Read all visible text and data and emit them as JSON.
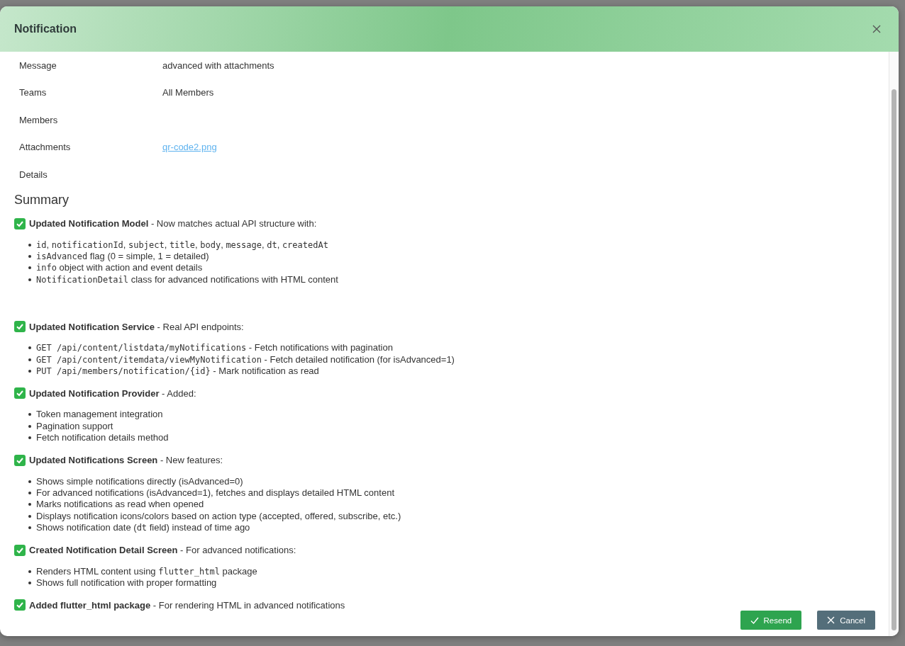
{
  "dialog": {
    "title": "Notification",
    "fields": [
      {
        "label": "Message",
        "value": "advanced with attachments",
        "kind": "text"
      },
      {
        "label": "Teams",
        "value": "All Members",
        "kind": "text"
      },
      {
        "label": "Members"
      },
      {
        "label": "Attachments",
        "value": "qr-code2.png",
        "kind": "link"
      },
      {
        "label": "Details"
      }
    ],
    "summary": {
      "heading": "Summary",
      "sections": [
        {
          "heading": "**Updated Notification Model** - Now matches actual API structure with:",
          "items": [
            [
              {
                "text": "id",
                "kind": "code"
              },
              {
                "text": ", ",
                "kind": "plain"
              },
              {
                "text": "notificationId",
                "kind": "code"
              },
              {
                "text": ", ",
                "kind": "plain"
              },
              {
                "text": "subject",
                "kind": "code"
              },
              {
                "text": ", ",
                "kind": "plain"
              },
              {
                "text": "title",
                "kind": "code"
              },
              {
                "text": ", ",
                "kind": "plain"
              },
              {
                "text": "body",
                "kind": "code"
              },
              {
                "text": ", ",
                "kind": "plain"
              },
              {
                "text": "message",
                "kind": "code"
              },
              {
                "text": ", ",
                "kind": "plain"
              },
              {
                "text": "dt",
                "kind": "code"
              },
              {
                "text": ", ",
                "kind": "plain"
              },
              {
                "text": "createdAt",
                "kind": "code"
              }
            ],
            [
              {
                "text": "isAdvanced",
                "kind": "code"
              },
              {
                "text": " flag (0 = simple, 1 = detailed)",
                "kind": "plain"
              }
            ],
            [
              {
                "text": "info",
                "kind": "code"
              },
              {
                "text": " object with action and event details",
                "kind": "plain"
              }
            ],
            [
              {
                "text": "NotificationDetail",
                "kind": "code"
              },
              {
                "text": " class for advanced notifications with HTML content",
                "kind": "plain"
              }
            ]
          ]
        },
        {
          "heading": "**Updated Notification Service** - Real API endpoints:",
          "items": [
            [
              {
                "text": "GET /api/content/listdata/myNotifications",
                "kind": "code"
              },
              {
                "text": " - Fetch notifications with pagination",
                "kind": "plain"
              }
            ],
            [
              {
                "text": "GET /api/content/itemdata/viewMyNotification",
                "kind": "code"
              },
              {
                "text": " - Fetch detailed notification (for isAdvanced=1)",
                "kind": "plain"
              }
            ],
            [
              {
                "text": "PUT /api/members/notification/{id}",
                "kind": "code"
              },
              {
                "text": " - Mark notification as read",
                "kind": "plain"
              }
            ]
          ]
        },
        {
          "heading": "**Updated Notification Provider** - Added:",
          "items": [
            [
              {
                "text": "Token management integration",
                "kind": "plain"
              }
            ],
            [
              {
                "text": "Pagination support",
                "kind": "plain"
              }
            ],
            [
              {
                "text": "Fetch notification details method",
                "kind": "plain"
              }
            ]
          ]
        },
        {
          "heading": "**Updated Notifications Screen** - New features:",
          "items": [
            [
              {
                "text": "Shows simple notifications directly (isAdvanced=0)",
                "kind": "plain"
              }
            ],
            [
              {
                "text": "For advanced notifications (isAdvanced=1), fetches and displays detailed HTML content",
                "kind": "plain"
              }
            ],
            [
              {
                "text": "Marks notifications as read when opened",
                "kind": "plain"
              }
            ],
            [
              {
                "text": "Displays notification icons/colors based on action type (accepted, offered, subscribe, etc.)",
                "kind": "plain"
              }
            ],
            [
              {
                "text": "Shows notification date (",
                "kind": "plain"
              },
              {
                "text": "dt",
                "kind": "code"
              },
              {
                "text": " field) instead of time ago",
                "kind": "plain"
              }
            ]
          ]
        },
        {
          "heading": "**Created Notification Detail Screen** - For advanced notifications:",
          "items": [
            [
              {
                "text": "Renders HTML content using ",
                "kind": "plain"
              },
              {
                "text": "flutter_html",
                "kind": "code"
              },
              {
                "text": " package",
                "kind": "plain"
              }
            ],
            [
              {
                "text": "Shows full notification with proper formatting",
                "kind": "plain"
              }
            ]
          ]
        },
        {
          "heading": "**Added flutter_html package** - For rendering HTML in advanced notifications"
        }
      ]
    },
    "buttons": [
      {
        "label": "Resend",
        "kind": "primary"
      },
      {
        "label": "Cancel",
        "kind": "secondary"
      }
    ]
  }
}
